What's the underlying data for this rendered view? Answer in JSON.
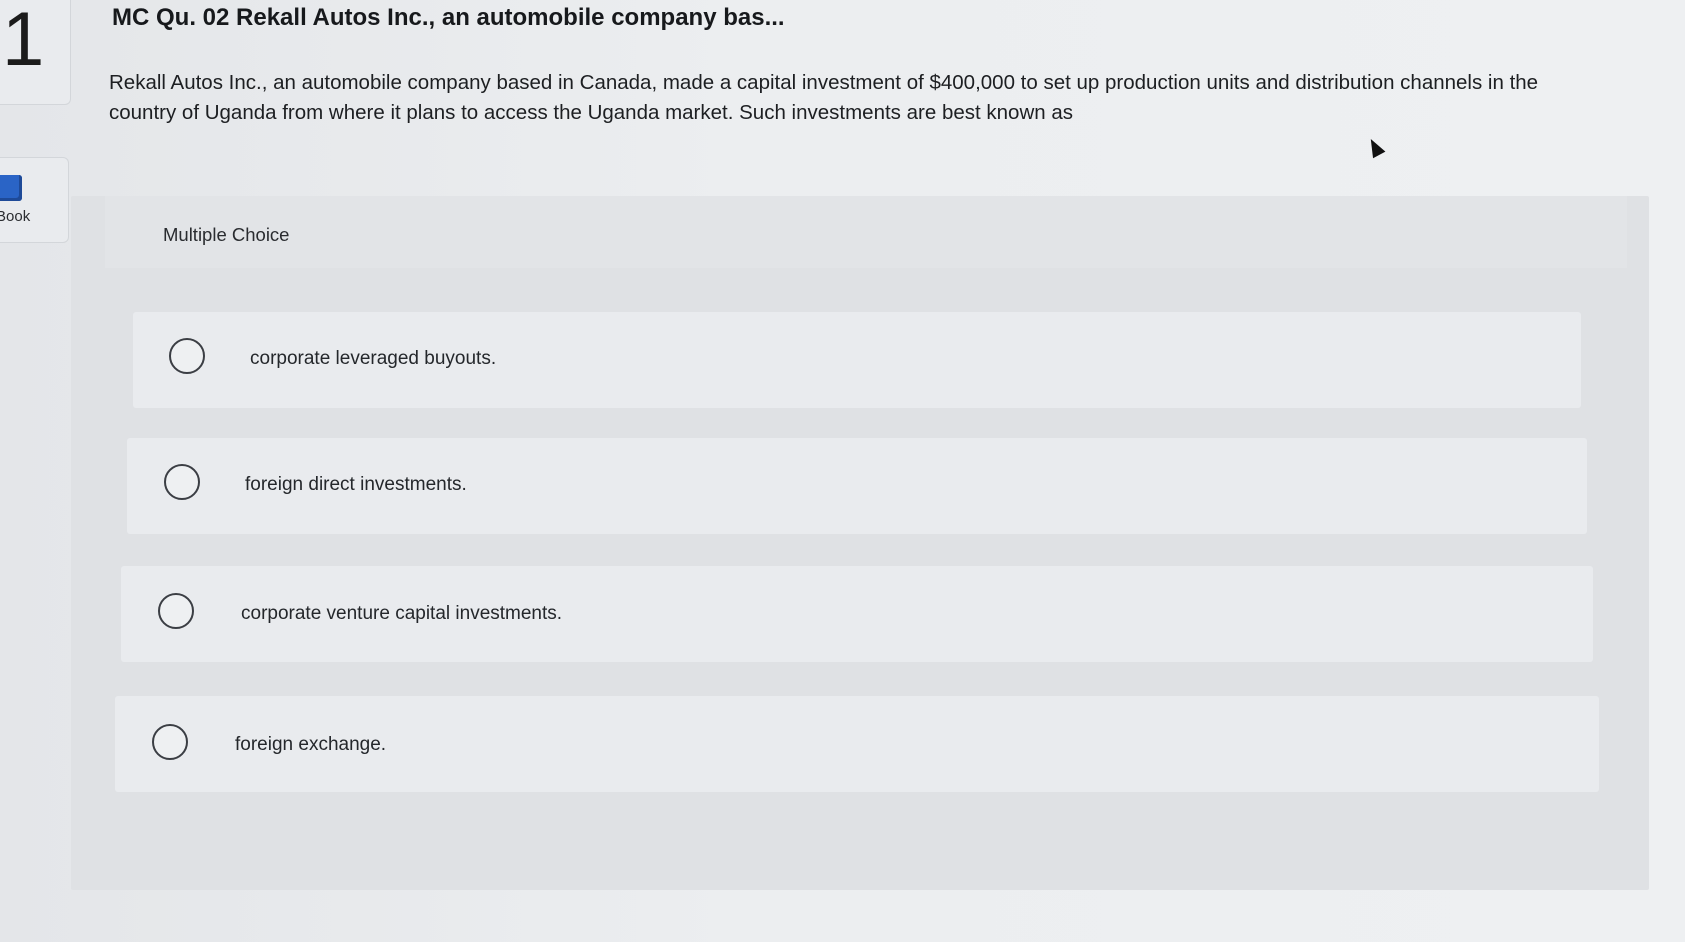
{
  "question": {
    "number": "1",
    "title": "MC Qu. 02 Rekall Autos Inc., an automobile company bas...",
    "body": "Rekall Autos Inc., an automobile company based in Canada, made a capital investment of $400,000 to set up production units and distribution channels in the country of Uganda from where it plans to access the Uganda market. Such investments are best known as"
  },
  "sidebar": {
    "ebook_label": "Book"
  },
  "multiple_choice": {
    "label": "Multiple Choice",
    "options": [
      {
        "label": "corporate leveraged buyouts."
      },
      {
        "label": "foreign direct investments."
      },
      {
        "label": "corporate venture capital investments."
      },
      {
        "label": "foreign exchange."
      }
    ]
  },
  "colors": {
    "ebook_icon": "#2a64c6",
    "background": "#eceef0",
    "panel": "#dfe1e4"
  }
}
